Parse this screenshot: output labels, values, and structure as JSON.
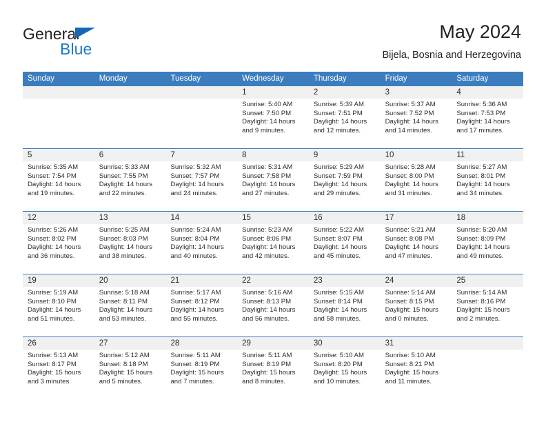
{
  "brand": {
    "name_top": "General",
    "name_bottom": "Blue"
  },
  "header": {
    "title": "May 2024",
    "subtitle": "Bijela, Bosnia and Herzegovina"
  },
  "colors": {
    "header_blue": "#3b7dbf",
    "brand_blue": "#1b79c4",
    "daynum_bg": "#f0f0f0",
    "text": "#2b2b2b"
  },
  "calendar": {
    "day_headers": [
      "Sunday",
      "Monday",
      "Tuesday",
      "Wednesday",
      "Thursday",
      "Friday",
      "Saturday"
    ],
    "weeks": [
      [
        {
          "day": "",
          "empty": true
        },
        {
          "day": "",
          "empty": true
        },
        {
          "day": "",
          "empty": true
        },
        {
          "day": "1",
          "sunrise": "Sunrise: 5:40 AM",
          "sunset": "Sunset: 7:50 PM",
          "daylight1": "Daylight: 14 hours",
          "daylight2": "and 9 minutes."
        },
        {
          "day": "2",
          "sunrise": "Sunrise: 5:39 AM",
          "sunset": "Sunset: 7:51 PM",
          "daylight1": "Daylight: 14 hours",
          "daylight2": "and 12 minutes."
        },
        {
          "day": "3",
          "sunrise": "Sunrise: 5:37 AM",
          "sunset": "Sunset: 7:52 PM",
          "daylight1": "Daylight: 14 hours",
          "daylight2": "and 14 minutes."
        },
        {
          "day": "4",
          "sunrise": "Sunrise: 5:36 AM",
          "sunset": "Sunset: 7:53 PM",
          "daylight1": "Daylight: 14 hours",
          "daylight2": "and 17 minutes."
        }
      ],
      [
        {
          "day": "5",
          "sunrise": "Sunrise: 5:35 AM",
          "sunset": "Sunset: 7:54 PM",
          "daylight1": "Daylight: 14 hours",
          "daylight2": "and 19 minutes."
        },
        {
          "day": "6",
          "sunrise": "Sunrise: 5:33 AM",
          "sunset": "Sunset: 7:55 PM",
          "daylight1": "Daylight: 14 hours",
          "daylight2": "and 22 minutes."
        },
        {
          "day": "7",
          "sunrise": "Sunrise: 5:32 AM",
          "sunset": "Sunset: 7:57 PM",
          "daylight1": "Daylight: 14 hours",
          "daylight2": "and 24 minutes."
        },
        {
          "day": "8",
          "sunrise": "Sunrise: 5:31 AM",
          "sunset": "Sunset: 7:58 PM",
          "daylight1": "Daylight: 14 hours",
          "daylight2": "and 27 minutes."
        },
        {
          "day": "9",
          "sunrise": "Sunrise: 5:29 AM",
          "sunset": "Sunset: 7:59 PM",
          "daylight1": "Daylight: 14 hours",
          "daylight2": "and 29 minutes."
        },
        {
          "day": "10",
          "sunrise": "Sunrise: 5:28 AM",
          "sunset": "Sunset: 8:00 PM",
          "daylight1": "Daylight: 14 hours",
          "daylight2": "and 31 minutes."
        },
        {
          "day": "11",
          "sunrise": "Sunrise: 5:27 AM",
          "sunset": "Sunset: 8:01 PM",
          "daylight1": "Daylight: 14 hours",
          "daylight2": "and 34 minutes."
        }
      ],
      [
        {
          "day": "12",
          "sunrise": "Sunrise: 5:26 AM",
          "sunset": "Sunset: 8:02 PM",
          "daylight1": "Daylight: 14 hours",
          "daylight2": "and 36 minutes."
        },
        {
          "day": "13",
          "sunrise": "Sunrise: 5:25 AM",
          "sunset": "Sunset: 8:03 PM",
          "daylight1": "Daylight: 14 hours",
          "daylight2": "and 38 minutes."
        },
        {
          "day": "14",
          "sunrise": "Sunrise: 5:24 AM",
          "sunset": "Sunset: 8:04 PM",
          "daylight1": "Daylight: 14 hours",
          "daylight2": "and 40 minutes."
        },
        {
          "day": "15",
          "sunrise": "Sunrise: 5:23 AM",
          "sunset": "Sunset: 8:06 PM",
          "daylight1": "Daylight: 14 hours",
          "daylight2": "and 42 minutes."
        },
        {
          "day": "16",
          "sunrise": "Sunrise: 5:22 AM",
          "sunset": "Sunset: 8:07 PM",
          "daylight1": "Daylight: 14 hours",
          "daylight2": "and 45 minutes."
        },
        {
          "day": "17",
          "sunrise": "Sunrise: 5:21 AM",
          "sunset": "Sunset: 8:08 PM",
          "daylight1": "Daylight: 14 hours",
          "daylight2": "and 47 minutes."
        },
        {
          "day": "18",
          "sunrise": "Sunrise: 5:20 AM",
          "sunset": "Sunset: 8:09 PM",
          "daylight1": "Daylight: 14 hours",
          "daylight2": "and 49 minutes."
        }
      ],
      [
        {
          "day": "19",
          "sunrise": "Sunrise: 5:19 AM",
          "sunset": "Sunset: 8:10 PM",
          "daylight1": "Daylight: 14 hours",
          "daylight2": "and 51 minutes."
        },
        {
          "day": "20",
          "sunrise": "Sunrise: 5:18 AM",
          "sunset": "Sunset: 8:11 PM",
          "daylight1": "Daylight: 14 hours",
          "daylight2": "and 53 minutes."
        },
        {
          "day": "21",
          "sunrise": "Sunrise: 5:17 AM",
          "sunset": "Sunset: 8:12 PM",
          "daylight1": "Daylight: 14 hours",
          "daylight2": "and 55 minutes."
        },
        {
          "day": "22",
          "sunrise": "Sunrise: 5:16 AM",
          "sunset": "Sunset: 8:13 PM",
          "daylight1": "Daylight: 14 hours",
          "daylight2": "and 56 minutes."
        },
        {
          "day": "23",
          "sunrise": "Sunrise: 5:15 AM",
          "sunset": "Sunset: 8:14 PM",
          "daylight1": "Daylight: 14 hours",
          "daylight2": "and 58 minutes."
        },
        {
          "day": "24",
          "sunrise": "Sunrise: 5:14 AM",
          "sunset": "Sunset: 8:15 PM",
          "daylight1": "Daylight: 15 hours",
          "daylight2": "and 0 minutes."
        },
        {
          "day": "25",
          "sunrise": "Sunrise: 5:14 AM",
          "sunset": "Sunset: 8:16 PM",
          "daylight1": "Daylight: 15 hours",
          "daylight2": "and 2 minutes."
        }
      ],
      [
        {
          "day": "26",
          "sunrise": "Sunrise: 5:13 AM",
          "sunset": "Sunset: 8:17 PM",
          "daylight1": "Daylight: 15 hours",
          "daylight2": "and 3 minutes."
        },
        {
          "day": "27",
          "sunrise": "Sunrise: 5:12 AM",
          "sunset": "Sunset: 8:18 PM",
          "daylight1": "Daylight: 15 hours",
          "daylight2": "and 5 minutes."
        },
        {
          "day": "28",
          "sunrise": "Sunrise: 5:11 AM",
          "sunset": "Sunset: 8:19 PM",
          "daylight1": "Daylight: 15 hours",
          "daylight2": "and 7 minutes."
        },
        {
          "day": "29",
          "sunrise": "Sunrise: 5:11 AM",
          "sunset": "Sunset: 8:19 PM",
          "daylight1": "Daylight: 15 hours",
          "daylight2": "and 8 minutes."
        },
        {
          "day": "30",
          "sunrise": "Sunrise: 5:10 AM",
          "sunset": "Sunset: 8:20 PM",
          "daylight1": "Daylight: 15 hours",
          "daylight2": "and 10 minutes."
        },
        {
          "day": "31",
          "sunrise": "Sunrise: 5:10 AM",
          "sunset": "Sunset: 8:21 PM",
          "daylight1": "Daylight: 15 hours",
          "daylight2": "and 11 minutes."
        },
        {
          "day": "",
          "empty": true
        }
      ]
    ]
  }
}
